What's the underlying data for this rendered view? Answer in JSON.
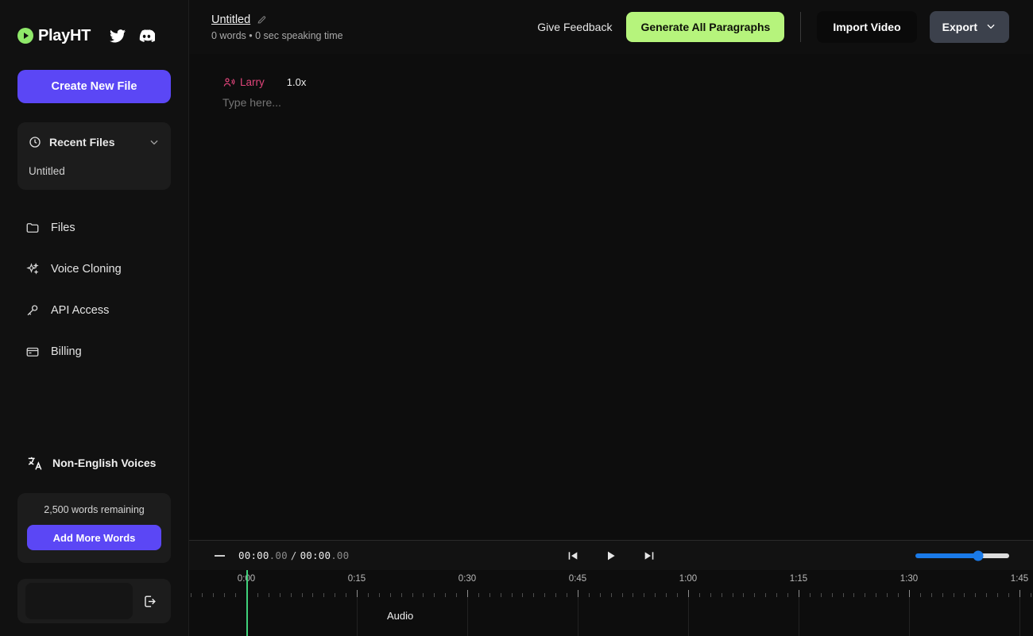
{
  "brand": {
    "name": "PlayHT",
    "logo_icon": "play-circle-icon",
    "accent_green": "#8fe86a",
    "social": [
      {
        "icon": "twitter-icon",
        "label": "Twitter"
      },
      {
        "icon": "discord-icon",
        "label": "Discord"
      }
    ]
  },
  "sidebar": {
    "create_button": "Create New File",
    "recent": {
      "icon": "clock-icon",
      "title": "Recent Files",
      "chevron": "chevron-down-icon",
      "items": [
        "Untitled"
      ]
    },
    "nav": [
      {
        "icon": "folder-icon",
        "label": "Files"
      },
      {
        "icon": "sparkles-icon",
        "label": "Voice Cloning"
      },
      {
        "icon": "key-icon",
        "label": "API Access"
      },
      {
        "icon": "credit-card-icon",
        "label": "Billing"
      }
    ],
    "non_english": {
      "icon": "translate-icon",
      "label": "Non-English Voices"
    },
    "words": {
      "remaining_text": "2,500 words remaining",
      "add_button": "Add More Words"
    },
    "profile": {
      "logout_icon": "logout-icon"
    },
    "accent_purple": "#5b47f5"
  },
  "topbar": {
    "doc_title": "Untitled",
    "edit_icon": "pencil-edit-icon",
    "doc_subtitle": "0 words • 0 sec speaking time",
    "feedback_label": "Give Feedback",
    "generate_label": "Generate All Paragraphs",
    "generate_color": "#b6f47c",
    "import_label": "Import Video",
    "export_label": "Export",
    "export_chevron": "chevron-down-icon",
    "export_color": "#3c414c"
  },
  "editor": {
    "voice_icon": "speaker-person-icon",
    "voice_name": "Larry",
    "voice_color": "#e0447a",
    "speed": "1.0x",
    "placeholder": "Type here..."
  },
  "player": {
    "collapse_icon": "minimize-icon",
    "current_time": "00:00",
    "current_frac": ".00",
    "separator": "/",
    "total_time": "00:00",
    "total_frac": ".00",
    "transport": [
      {
        "icon": "skip-to-start-icon",
        "label": "Skip to start"
      },
      {
        "icon": "play-icon",
        "label": "Play"
      },
      {
        "icon": "skip-to-end-icon",
        "label": "Skip to end"
      }
    ],
    "zoom_slider": {
      "value": 67,
      "color": "#1a7ae8"
    }
  },
  "timeline": {
    "track_label": "Audio",
    "playhead_color": "#3fd17a",
    "playhead_time": "0:00",
    "tick_labels": [
      "0:00",
      "0:15",
      "0:30",
      "0:45",
      "1:00",
      "1:15",
      "1:30",
      "1:45"
    ]
  }
}
